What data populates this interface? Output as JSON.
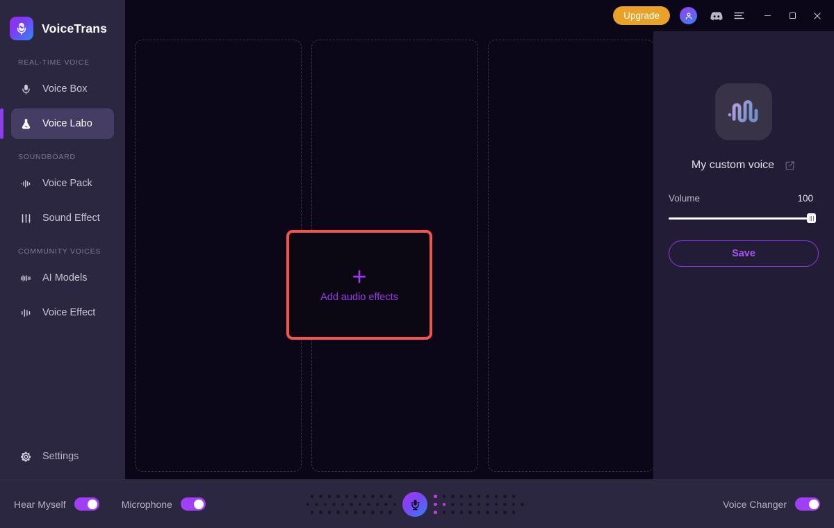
{
  "app": {
    "brand_name": "VoiceTrans",
    "logo_icon": "microphone-waveform-logo"
  },
  "titlebar": {
    "upgrade_label": "Upgrade",
    "avatar_icon": "user-avatar-icon",
    "discord_icon": "discord-icon",
    "menu_icon": "hamburger-menu-icon",
    "minimize_icon": "minimize-icon",
    "maximize_icon": "maximize-icon",
    "close_icon": "close-icon"
  },
  "sidebar": {
    "sections": [
      {
        "title": "REAL-TIME VOICE",
        "items": [
          {
            "label": "Voice Box",
            "icon": "microphone-icon",
            "active": false
          },
          {
            "label": "Voice Labo",
            "icon": "flask-icon",
            "active": true
          }
        ]
      },
      {
        "title": "SOUNDBOARD",
        "items": [
          {
            "label": "Voice Pack",
            "icon": "waveform-bars-icon",
            "active": false
          },
          {
            "label": "Sound Effect",
            "icon": "sliders-icon",
            "active": false
          }
        ]
      },
      {
        "title": "COMMUNITY VOICES",
        "items": [
          {
            "label": "AI Models",
            "icon": "ai-waveform-icon",
            "active": false
          },
          {
            "label": "Voice Effect",
            "icon": "equalizer-icon",
            "active": false
          }
        ]
      }
    ],
    "settings": {
      "label": "Settings",
      "icon": "gear-icon"
    }
  },
  "main": {
    "dropzones": [
      {
        "name": "dropzone-1"
      },
      {
        "name": "dropzone-2"
      },
      {
        "name": "dropzone-3"
      }
    ],
    "add_card": {
      "plus": "+",
      "label": "Add audio effects",
      "highlight_color": "#f4544f",
      "accent_color": "#9a3bea"
    }
  },
  "right_panel": {
    "voice_avatar_icon": "voice-waveform-avatar-icon",
    "voice_name": "My custom voice",
    "edit_icon": "edit-pencil-icon",
    "volume_label": "Volume",
    "volume_value": "100",
    "save_label": "Save",
    "accent_color": "#a855f7"
  },
  "bottom_bar": {
    "hear_myself_label": "Hear Myself",
    "hear_myself_on": true,
    "microphone_label": "Microphone",
    "microphone_on": true,
    "mic_button_icon": "microphone-icon",
    "voice_changer_label": "Voice Changer",
    "voice_changer_on": true,
    "toggle_on_color": "#a03ff5"
  }
}
